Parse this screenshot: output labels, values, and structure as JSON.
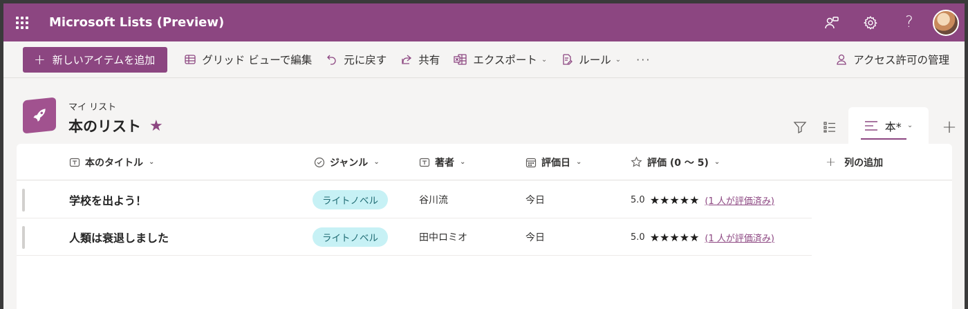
{
  "app": {
    "title": "Microsoft Lists (Preview)",
    "brand_color": "#8c4681"
  },
  "suite_icons": [
    "people-connect-icon",
    "gear-icon",
    "help-icon",
    "avatar"
  ],
  "suite_help_glyph": "?",
  "commandbar": {
    "new_item_plus": "+",
    "new_item": "新しいアイテムを追加",
    "grid_edit": "グリッド ビューで編集",
    "undo": "元に戻す",
    "share": "共有",
    "export": "エクスポート",
    "rules": "ルール",
    "more": "···",
    "manage_access": "アクセス許可の管理"
  },
  "list": {
    "breadcrumb": "マイ リスト",
    "title": "本のリスト",
    "favorite_star": "★"
  },
  "views": {
    "active_view": "本*",
    "add_view": "+"
  },
  "columns": [
    {
      "label": "本のタイトル",
      "icon": "text-icon"
    },
    {
      "label": "ジャンル",
      "icon": "choice-icon"
    },
    {
      "label": "著者",
      "icon": "text-icon"
    },
    {
      "label": "評価日",
      "icon": "calendar-icon"
    },
    {
      "label": "評価 (0 ～ 5)",
      "icon": "star-outline-icon"
    },
    {
      "label": "列の追加",
      "icon": "plus-icon"
    }
  ],
  "add_column_plus": "+",
  "chevron": "⌄",
  "rows": [
    {
      "title": "学校を出よう！",
      "genre": "ライトノベル",
      "author": "谷川流",
      "date": "今日",
      "rating": "5.0",
      "stars": "★★★★★",
      "rating_count": "(1 人が評価済み)"
    },
    {
      "title": "人類は衰退しました",
      "genre": "ライトノベル",
      "author": "田中ロミオ",
      "date": "今日",
      "rating": "5.0",
      "stars": "★★★★★",
      "rating_count": "(1 人が評価済み)"
    }
  ]
}
